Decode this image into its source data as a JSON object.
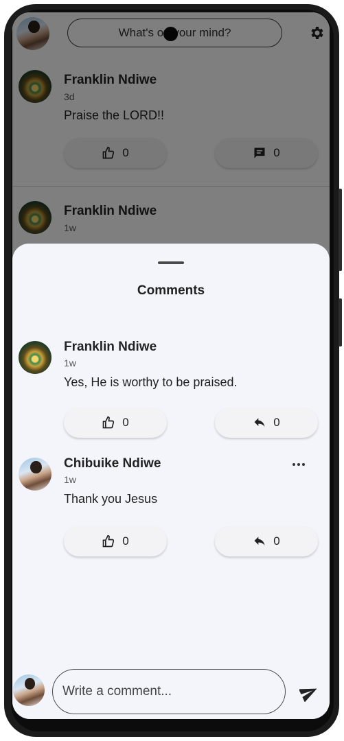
{
  "feed": {
    "composer_prompt": "What's on your mind?",
    "posts": [
      {
        "author": "Franklin Ndiwe",
        "time": "3d",
        "text": "Praise the LORD!!",
        "likes": "0",
        "comments": "0"
      },
      {
        "author": "Franklin Ndiwe",
        "time": "1w"
      }
    ]
  },
  "sheet": {
    "title": "Comments",
    "comments": [
      {
        "author": "Franklin Ndiwe",
        "time": "1w",
        "text": "Yes, He is worthy to be praised.",
        "likes": "0",
        "replies": "0"
      },
      {
        "author": "Chibuike Ndiwe",
        "time": "1w",
        "text": "Thank you Jesus",
        "likes": "0",
        "replies": "0"
      }
    ],
    "input_placeholder": "Write a comment..."
  },
  "icons": {
    "like": "thumb-up-icon",
    "comment": "comment-icon",
    "reply": "reply-icon",
    "more": "more-horizontal-icon",
    "send": "send-icon",
    "settings": "gear-icon"
  },
  "colors": {
    "sheet_bg": "#f4f5fb",
    "scrim": "rgba(0,0,0,0.5)",
    "text": "#222222"
  }
}
